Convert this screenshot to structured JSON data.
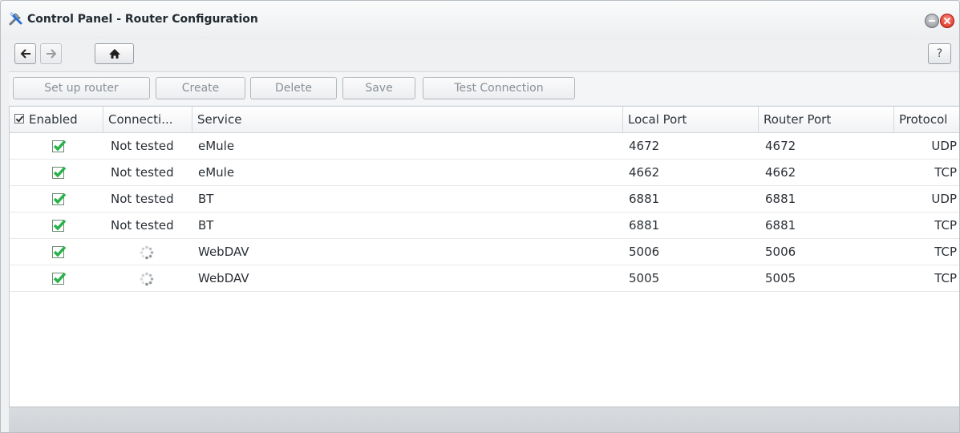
{
  "window": {
    "title": "Control Panel - Router Configuration"
  },
  "nav": {
    "help_label": "?"
  },
  "toolbar": {
    "setup_label": "Set up router",
    "create_label": "Create",
    "delete_label": "Delete",
    "save_label": "Save",
    "test_label": "Test Connection"
  },
  "table": {
    "headers": {
      "enabled": "Enabled",
      "connection": "Connecti...",
      "service": "Service",
      "local_port": "Local Port",
      "router_port": "Router Port",
      "protocol": "Protocol"
    },
    "rows": [
      {
        "enabled": true,
        "connection": "Not tested",
        "service": "eMule",
        "local_port": "4672",
        "router_port": "4672",
        "protocol": "UDP"
      },
      {
        "enabled": true,
        "connection": "Not tested",
        "service": "eMule",
        "local_port": "4662",
        "router_port": "4662",
        "protocol": "TCP"
      },
      {
        "enabled": true,
        "connection": "Not tested",
        "service": "BT",
        "local_port": "6881",
        "router_port": "6881",
        "protocol": "UDP"
      },
      {
        "enabled": true,
        "connection": "Not tested",
        "service": "BT",
        "local_port": "6881",
        "router_port": "6881",
        "protocol": "TCP"
      },
      {
        "enabled": true,
        "connection": "",
        "connection_icon": "loading-spinner-icon",
        "service": "WebDAV",
        "local_port": "5006",
        "router_port": "5006",
        "protocol": "TCP"
      },
      {
        "enabled": true,
        "connection": "",
        "connection_icon": "loading-spinner-icon",
        "service": "WebDAV",
        "local_port": "5005",
        "router_port": "5005",
        "protocol": "TCP"
      }
    ]
  },
  "colors": {
    "check_green": "#27b34a",
    "close_red": "#d62818"
  }
}
